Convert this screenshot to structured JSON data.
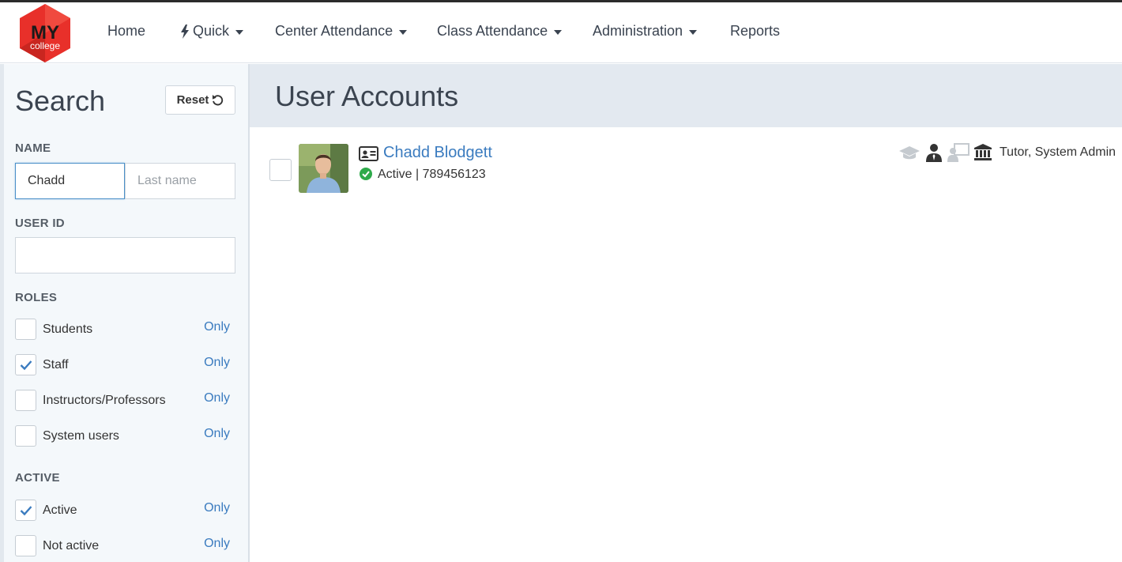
{
  "app": {
    "logo_text_top": "MY",
    "logo_text_bottom": "college"
  },
  "nav": {
    "items": [
      {
        "label": "Home",
        "dropdown": false
      },
      {
        "label": "Quick",
        "dropdown": true,
        "icon": "bolt-icon"
      },
      {
        "label": "Center Attendance",
        "dropdown": true
      },
      {
        "label": "Class Attendance",
        "dropdown": true
      },
      {
        "label": "Administration",
        "dropdown": true
      },
      {
        "label": "Reports",
        "dropdown": false
      }
    ]
  },
  "sidebar": {
    "title": "Search",
    "reset_label": "Reset",
    "name": {
      "label": "NAME",
      "first_value": "Chadd",
      "last_placeholder": "Last name"
    },
    "user_id": {
      "label": "USER ID",
      "value": ""
    },
    "roles": {
      "label": "ROLES",
      "options": [
        {
          "label": "Students",
          "checked": false,
          "only": "Only"
        },
        {
          "label": "Staff",
          "checked": true,
          "only": "Only"
        },
        {
          "label": "Instructors/Professors",
          "checked": false,
          "only": "Only"
        },
        {
          "label": "System users",
          "checked": false,
          "only": "Only"
        }
      ]
    },
    "active": {
      "label": "ACTIVE",
      "options": [
        {
          "label": "Active",
          "checked": true,
          "only": "Only"
        },
        {
          "label": "Not active",
          "checked": false,
          "only": "Only"
        }
      ]
    }
  },
  "main": {
    "title": "User Accounts",
    "results": [
      {
        "name": "Chadd Blodgett",
        "status": "Active | 789456123",
        "roles": "Tutor, System Admin"
      }
    ]
  },
  "colors": {
    "accent": "#3a7bbf",
    "logo_red": "#e8302a",
    "success": "#2eaa4a",
    "header_bg": "#e3e9f0",
    "sidebar_bg": "#f4f8fb"
  }
}
